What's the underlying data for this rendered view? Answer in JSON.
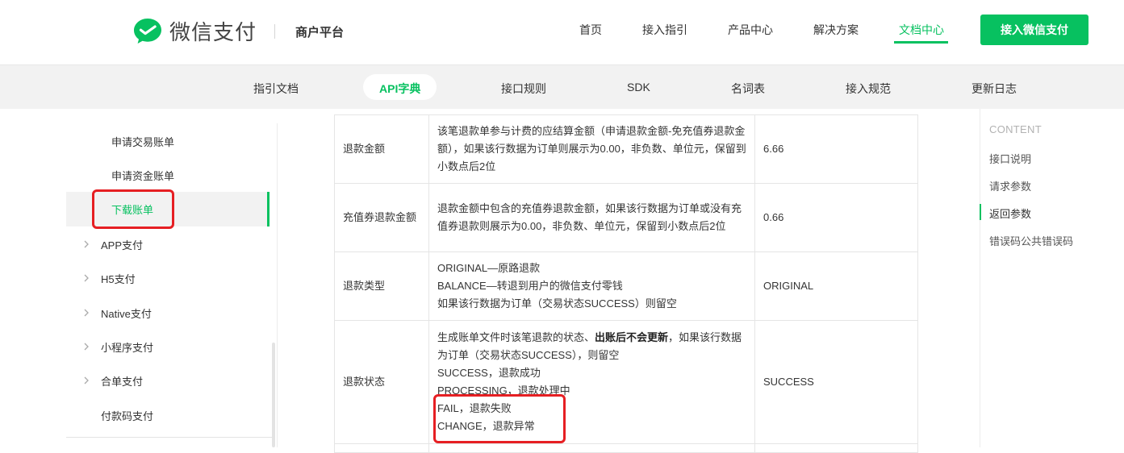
{
  "header": {
    "brand": "微信支付",
    "platform": "商户平台",
    "nav": [
      {
        "label": "首页"
      },
      {
        "label": "接入指引"
      },
      {
        "label": "产品中心"
      },
      {
        "label": "解决方案"
      },
      {
        "label": "文档中心"
      }
    ],
    "active_nav": "文档中心",
    "cta_label": "接入微信支付"
  },
  "subnav": {
    "items": [
      {
        "label": "指引文档"
      },
      {
        "label": "API字典"
      },
      {
        "label": "接口规则"
      },
      {
        "label": "SDK"
      },
      {
        "label": "名词表"
      },
      {
        "label": "接入规范"
      },
      {
        "label": "更新日志"
      }
    ],
    "active": "API字典"
  },
  "sidebar": {
    "items": [
      {
        "label": "申请交易账单"
      },
      {
        "label": "申请资金账单"
      },
      {
        "label": "下载账单"
      },
      {
        "label": "APP支付"
      },
      {
        "label": "H5支付"
      },
      {
        "label": "Native支付"
      },
      {
        "label": "小程序支付"
      },
      {
        "label": "合单支付"
      },
      {
        "label": "付款码支付"
      }
    ],
    "active": "下载账单"
  },
  "table": {
    "rows": [
      {
        "name": "退款金额",
        "desc": [
          "该笔退款单参与计费的应结算金额（申请退款金额-免充值券退款金额），如果该行数据为订单则展示为0.00，非负数、单位元，保留到小数点后2位"
        ],
        "example": "6.66"
      },
      {
        "name": "充值券退款金额",
        "desc": [
          "退款金额中包含的充值券退款金额，如果该行数据为订单或没有充值券退款则展示为0.00，非负数、单位元，保留到小数点后2位"
        ],
        "example": "0.66"
      },
      {
        "name": "退款类型",
        "desc": [
          "ORIGINAL—原路退款",
          "BALANCE—转退到用户的微信支付零钱",
          "如果该行数据为订单（交易状态SUCCESS）则留空"
        ],
        "example": "ORIGINAL"
      },
      {
        "name": "退款状态",
        "desc_pre": "生成账单文件时该笔退款的状态、",
        "desc_bold": "出账后不会更新",
        "desc_post": "，如果该行数据为订单（交易状态SUCCESS），则留空",
        "desc": [
          "SUCCESS，退款成功",
          "PROCESSING，退款处理中",
          "FAIL，退款失败",
          "CHANGE，退款异常"
        ],
        "example": "SUCCESS"
      }
    ]
  },
  "toc": {
    "title": "CONTENT",
    "items": [
      {
        "label": "接口说明"
      },
      {
        "label": "请求参数"
      },
      {
        "label": "返回参数"
      },
      {
        "label": "错误码公共错误码"
      }
    ],
    "active": "返回参数"
  },
  "colors": {
    "accent": "#07c160",
    "highlight_box": "#e61f23"
  }
}
